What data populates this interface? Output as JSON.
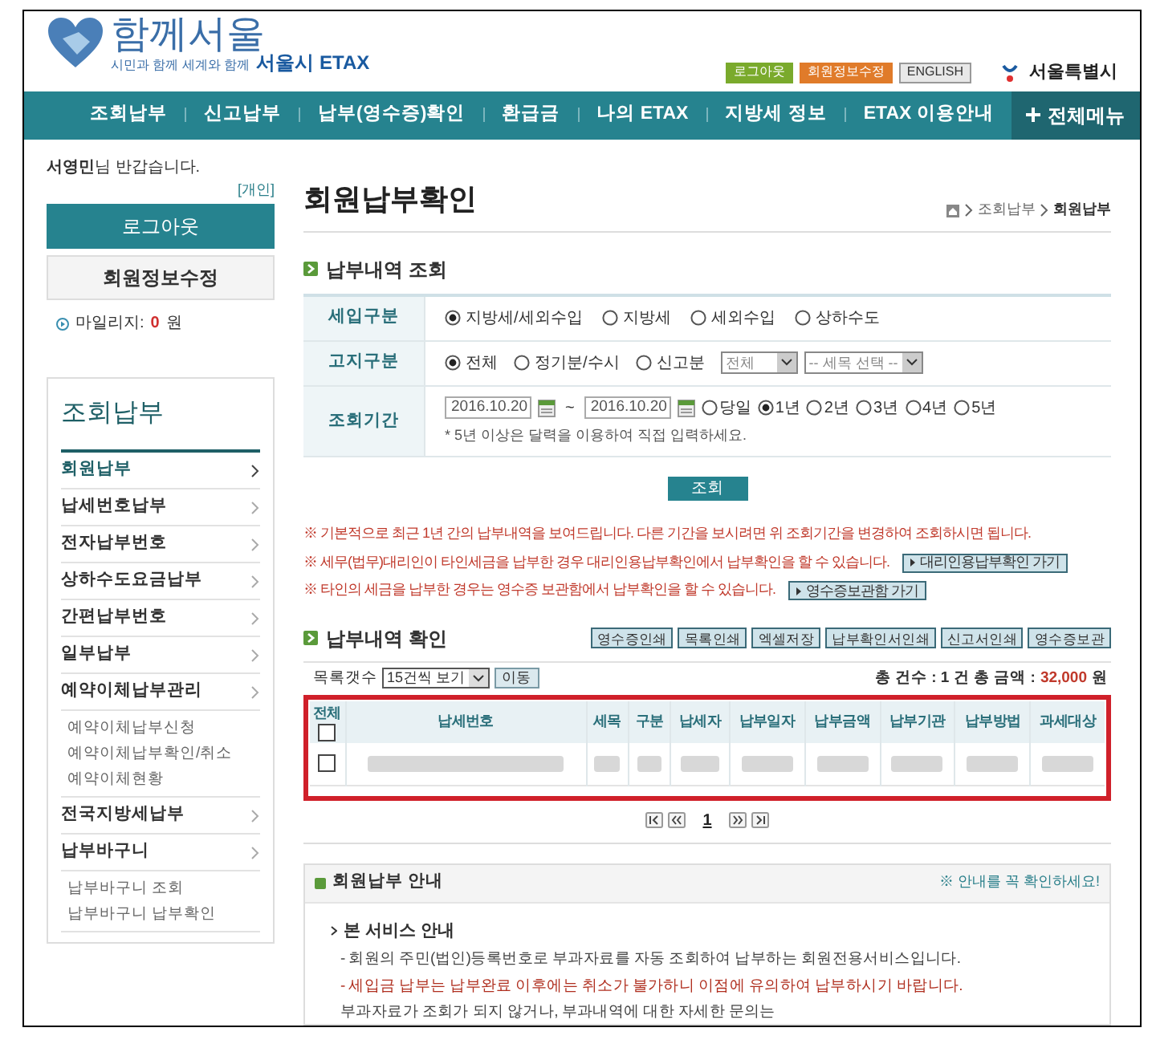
{
  "header": {
    "logo_title": "함께서울",
    "logo_slogan": "시민과 함께 세계와 함께",
    "logo_suffix": "서울시 ETAX",
    "top_buttons": [
      {
        "label": "로그아웃",
        "color": "#7aaa2c"
      },
      {
        "label": "회원정보수정",
        "color": "#e07b2a"
      },
      {
        "label": "ENGLISH",
        "color": "#e8e8e8"
      }
    ],
    "city": "서울특별시"
  },
  "nav": {
    "items": [
      "조회납부",
      "신고납부",
      "납부(영수증)확인",
      "환급금",
      "나의 ETAX",
      "지방세 정보",
      "ETAX 이용안내"
    ],
    "all_menu": "전체메뉴"
  },
  "sidebar": {
    "greeting": "**서영민**님 반갑습니다.",
    "member_type": "[개인]",
    "logout": "로그아웃",
    "edit_profile": "회원정보수정",
    "mileage_label": "마일리지:",
    "mileage_value": "0",
    "mileage_unit": "원",
    "menu_title": "조회납부",
    "items": [
      {
        "label": "회원납부",
        "selected": true
      },
      {
        "label": "납세번호납부",
        "selected": false
      },
      {
        "label": "전자납부번호",
        "selected": false
      },
      {
        "label": "상하수도요금납부",
        "selected": false
      },
      {
        "label": "간편납부번호",
        "selected": false
      },
      {
        "label": "일부납부",
        "selected": false
      },
      {
        "label": "예약이체납부관리",
        "selected": false,
        "children": [
          "예약이체납부신청",
          "예약이체납부확인/취소",
          "예약이체현황"
        ]
      },
      {
        "label": "전국지방세납부",
        "selected": false
      },
      {
        "label": "납부바구니",
        "selected": false,
        "children": [
          "납부바구니 조회",
          "납부바구니 납부확인"
        ]
      }
    ]
  },
  "main": {
    "title": "회원납부확인",
    "breadcrumb": [
      "조회납부",
      "회원납부"
    ],
    "search_section": "납부내역 조회",
    "form": [
      {
        "label": "세입구분",
        "kind": "radios",
        "options": [
          {
            "label": "지방세/세외수입",
            "selected": true
          },
          {
            "label": "지방세",
            "selected": false
          },
          {
            "label": "세외수입",
            "selected": false
          },
          {
            "label": "상하수도",
            "selected": false
          }
        ]
      },
      {
        "label": "고지구분",
        "kind": "radios_selects",
        "options": [
          {
            "label": "전체",
            "selected": true
          },
          {
            "label": "정기분/수시",
            "selected": false
          },
          {
            "label": "신고분",
            "selected": false
          }
        ],
        "selects": [
          "전체",
          "-- 세목 선택 --"
        ]
      },
      {
        "label": "조회기간",
        "kind": "period",
        "from": "2016.10.20",
        "to": "2016.10.20",
        "separator": "~",
        "options": [
          {
            "label": "당일",
            "selected": false
          },
          {
            "label": "1년",
            "selected": true
          },
          {
            "label": "2년",
            "selected": false
          },
          {
            "label": "3년",
            "selected": false
          },
          {
            "label": "4년",
            "selected": false
          },
          {
            "label": "5년",
            "selected": false
          }
        ],
        "note": "* 5년 이상은 달력을 이용하여 직접 입력하세요."
      }
    ],
    "search_button": "조회",
    "notices": [
      {
        "text": "※ 기본적으로 최근 1년 간의 납부내역을 보여드립니다. 다른 기간을 보시려면 위 조회기간을 변경하여 조회하시면 됩니다."
      },
      {
        "text": "※ 세무(법무)대리인이 타인세금을 납부한 경우 대리인용납부확인에서 납부확인을 할 수 있습니다.",
        "button": "대리인용납부확인 가기"
      },
      {
        "text": "※ 타인의 세금을 납부한 경우는 영수증 보관함에서 납부확인을 할 수 있습니다.",
        "button": "영수증보관함 가기"
      }
    ],
    "result_section": "납부내역 확인",
    "action_buttons": [
      "영수증인쇄",
      "목록인쇄",
      "엑셀저장",
      "납부확인서인쇄",
      "신고서인쇄",
      "영수증보관"
    ],
    "page_size_label": "목록갯수",
    "page_size": "15건씩 보기",
    "go_button": "이동",
    "total_label": "총 건수 : 1 건 총 금액 :",
    "total_amount": "32,000",
    "total_unit": "원",
    "table": {
      "select_all": "전체",
      "select_all_checked": false,
      "columns": [
        "납세번호",
        "세목",
        "구분",
        "납세자",
        "납부일자",
        "납부금액",
        "납부기관",
        "납부방법",
        "과세대상"
      ],
      "rows": [
        {
          "checked": false
        }
      ]
    },
    "pagination": {
      "pages": [
        {
          "label": "1",
          "selected": true
        }
      ]
    },
    "guide": {
      "title": "회원납부 안내",
      "hint": "※ 안내를 꼭 확인하세요!",
      "heading": "본 서비스 안내",
      "lines": [
        {
          "text": "- 회원의 주민(법인)등록번호로 부과자료를 자동 조회하여 납부하는 회원전용서비스입니다.",
          "kind": "normal"
        },
        {
          "text": "- 세입금 납부는 납부완료 이후에는 취소가 불가하니 이점에 유의하여 납부하시기 바랍니다.",
          "kind": "warning"
        },
        {
          "text": "부과자료가 조회가 되지 않거나, 부과내역에 대한 자세한 문의는",
          "kind": "normal"
        }
      ]
    }
  }
}
